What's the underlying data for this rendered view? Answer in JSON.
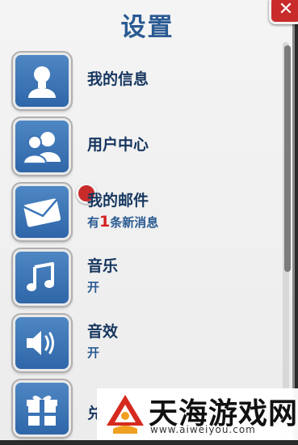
{
  "header": {
    "title": "设置"
  },
  "close_button": {
    "label": "✕",
    "icon": "close-icon"
  },
  "menu": [
    {
      "id": "profile",
      "icon": "user-icon",
      "label": "我的信息"
    },
    {
      "id": "usercenter",
      "icon": "users-icon",
      "label": "用户中心"
    },
    {
      "id": "mail",
      "icon": "mail-icon",
      "label": "我的邮件",
      "sub_prefix": "有",
      "sub_count": "1",
      "sub_suffix": "条新消息",
      "badge": true
    },
    {
      "id": "music",
      "icon": "music-note-icon",
      "label": "音乐",
      "status": "开"
    },
    {
      "id": "sound",
      "icon": "speaker-icon",
      "label": "音效",
      "status": "开"
    },
    {
      "id": "gift",
      "icon": "gift-icon",
      "label": "兑"
    }
  ],
  "watermark": {
    "title": "天海游戏网",
    "url": "www.aiweiyou.com"
  },
  "colors": {
    "accent": "#2a5a92",
    "tile": "#3a73b5",
    "alert": "#c92b2b"
  }
}
